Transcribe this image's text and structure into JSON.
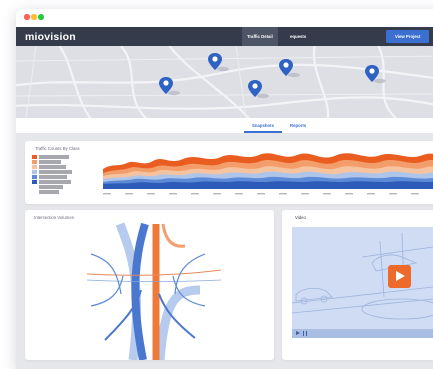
{
  "app": {
    "logo": "miovision"
  },
  "header": {
    "tabs": [
      {
        "label": "Traffic Detail",
        "active": true
      },
      {
        "label": "equests",
        "active": false
      }
    ],
    "view_button": "View Project"
  },
  "map": {
    "pin_icon": "map-pin-icon",
    "pin_color": "#2e63c4",
    "pin_count": 5
  },
  "subnav": {
    "tabs": [
      {
        "label": "Snapshots",
        "active": true
      },
      {
        "label": "Reports",
        "active": false
      }
    ]
  },
  "traffic_counts": {
    "title": "Traffic Counts By Class",
    "legend_colors": [
      "#e95d21",
      "#f39e6a",
      "#f6c3a0",
      "#aec5ea",
      "#5d8ad6",
      "#2d5bb8"
    ],
    "stream_colors": [
      "#2d5bb8",
      "#5d8ad6",
      "#aec5ea",
      "#f6c3a0",
      "#f39e6a",
      "#e95d21"
    ]
  },
  "intersection": {
    "title": "Intersection Volumes"
  },
  "video": {
    "title": "Video",
    "play_icon": "play-icon",
    "accent": "#ee6a2a"
  },
  "colors": {
    "header_bg": "#353b4a",
    "brand_blue": "#3b6fd0",
    "orange": "#e95d21",
    "page_bg": "#e6e7ea"
  }
}
